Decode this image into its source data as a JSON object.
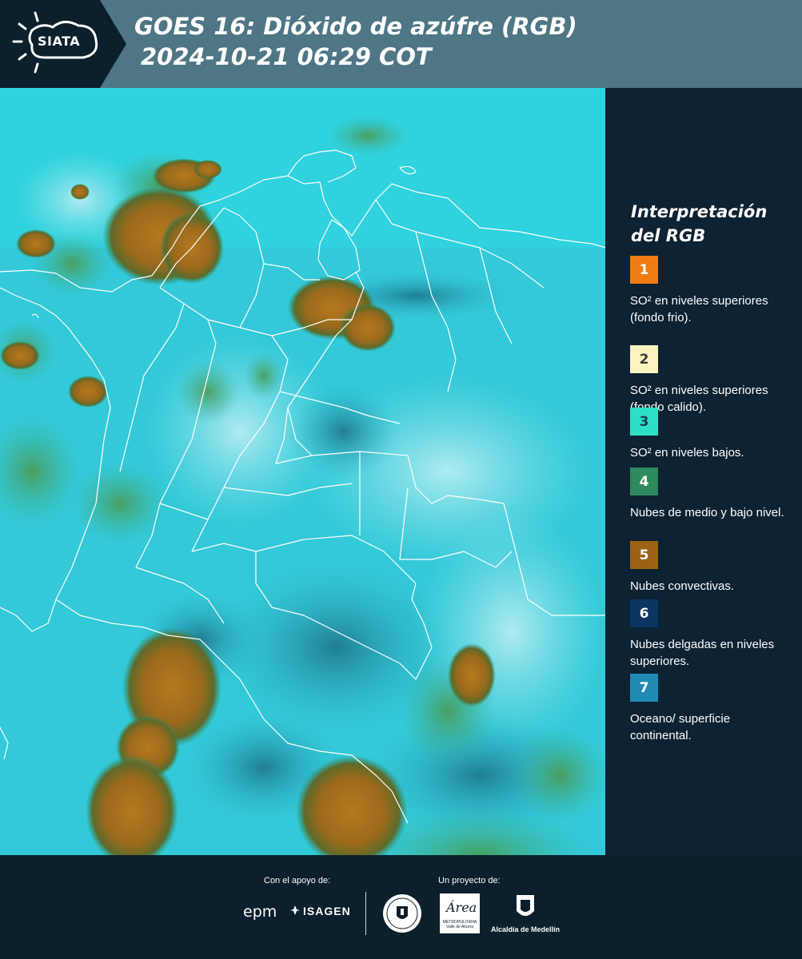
{
  "header": {
    "logo_text": "SIATA",
    "title_line1": "GOES 16: Dióxido de azúfre (RGB)",
    "title_line2": "2024-10-21 06:29 COT"
  },
  "legend": {
    "title": "Interpretación del RGB",
    "items": [
      {
        "number": "1",
        "label": "SO² en niveles superiores (fondo frio).",
        "color": "#f07c14",
        "text_color": "#ffffff"
      },
      {
        "number": "2",
        "label": "SO² en niveles superiores (fondo calido).",
        "color": "#fbf4bf",
        "text_color": "#3a3a3a"
      },
      {
        "number": "3",
        "label": "SO² en niveles bajos.",
        "color": "#2de0c5",
        "text_color": "#1b3a4a"
      },
      {
        "number": "4",
        "label": "Nubes de medio y bajo nivel.",
        "color": "#2e8a5e",
        "text_color": "#ffffff"
      },
      {
        "number": "5",
        "label": "Nubes convectivas.",
        "color": "#9b6212",
        "text_color": "#ffffff"
      },
      {
        "number": "6",
        "label": "Nubes delgadas en niveles superiores.",
        "color": "#0c3563",
        "text_color": "#ffffff"
      },
      {
        "number": "7",
        "label": "Oceano/ superficie continental.",
        "color": "#1f8bb4",
        "text_color": "#ffffff"
      }
    ]
  },
  "footer": {
    "support_label": "Con el apoyo de:",
    "project_label": "Un proyecto de:",
    "epm_text": "epm",
    "isagen_text": "ISAGEN",
    "area_text": "Área",
    "area_sub": "METROPOLITANA Valle de Aburrá",
    "alcaldia_text": "Alcaldía de Medellín"
  }
}
